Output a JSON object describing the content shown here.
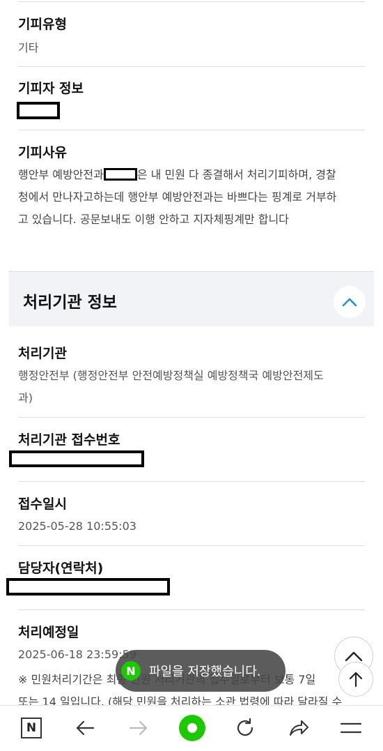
{
  "fields": {
    "refusal_type": {
      "label": "기피유형",
      "value": "기타"
    },
    "refused_person": {
      "label": "기피자 정보"
    },
    "reason": {
      "label": "기피사유",
      "text_before": "행안부 예방안전과",
      "text_after": "은 내 민원 다 종결해서 처리기피하며, 경찰",
      "line2": "청에서 만나자고하는데 행안부 예방안전과는 바쁘다는 핑계로 거부하",
      "line3": "고 있습니다. 공문보내도 이행 안하고 지자체핑계만 합니다"
    }
  },
  "panel": {
    "title": "처리기관 정보"
  },
  "processing": {
    "agency": {
      "label": "처리기관",
      "line1": "행정안전부 (행정안전부 안전예방정책실 예방정책국 예방안전제도",
      "line2": "과)"
    },
    "receipt_no": {
      "label": "처리기관 접수번호"
    },
    "received_at": {
      "label": "접수일시",
      "value": "2025-05-28 10:55:03"
    },
    "manager": {
      "label": "담당자(연락처)"
    },
    "due_date": {
      "label": "처리예정일",
      "value": "2025-06-18 23:59:59"
    },
    "notice_line1": "※ 민원처리기간은 최종 민원 처리기관의 접수일로부터 보통 7일",
    "notice_line2": "또는 14 일입니다. (해당 민원을 처리하는 소관 법령에 따라 달라질 수"
  },
  "toast": {
    "icon": "N",
    "text": "파일을 저장했습니다."
  },
  "toolbar": {
    "icons": [
      "naver-n-icon",
      "back-arrow-icon",
      "forward-arrow-icon",
      "home-dot-icon",
      "refresh-icon",
      "share-icon",
      "menu-icon"
    ],
    "n_label": "N"
  },
  "colors": {
    "accent_green": "#1ec800",
    "chevron_blue": "#2b8fd6"
  }
}
